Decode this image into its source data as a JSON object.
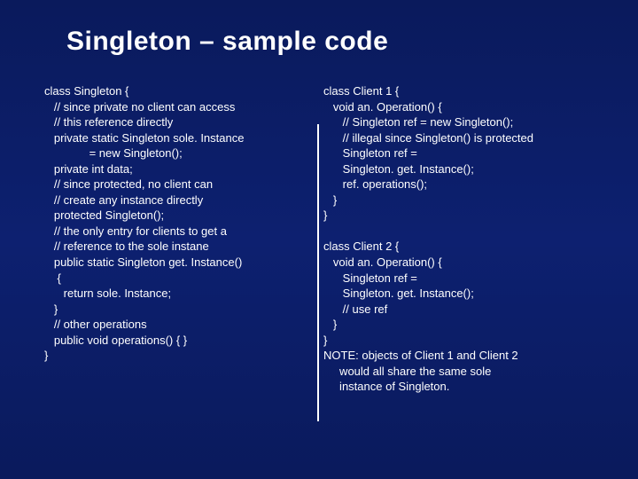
{
  "title": "Singleton – sample code",
  "left_code": "class Singleton {\n   // since private no client can access\n   // this reference directly\n   private static Singleton sole. Instance\n              = new Singleton();\n   private int data;\n   // since protected, no client can\n   // create any instance directly\n   protected Singleton();\n   // the only entry for clients to get a\n   // reference to the sole instane\n   public static Singleton get. Instance()\n    {\n      return sole. Instance;\n   }\n   // other operations\n   public void operations() { }\n}",
  "right_code": "class Client 1 {\n   void an. Operation() {\n      // Singleton ref = new Singleton();\n      // illegal since Singleton() is protected\n      Singleton ref =\n      Singleton. get. Instance();\n      ref. operations();\n   }\n}\n\nclass Client 2 {\n   void an. Operation() {\n      Singleton ref =\n      Singleton. get. Instance();\n      // use ref\n   }\n}\nNOTE: objects of Client 1 and Client 2\n     would all share the same sole\n     instance of Singleton."
}
